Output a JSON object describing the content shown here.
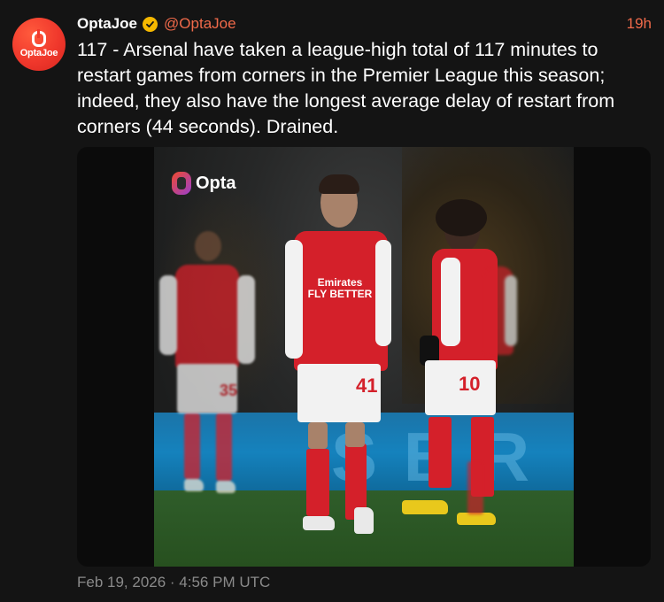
{
  "author": {
    "display_name": "OptaJoe",
    "handle": "@OptaJoe",
    "avatar_text": "OptaJoe",
    "verified": true
  },
  "time_ago": "19h",
  "text": "117 - Arsenal have taken a league-high total of 117 minutes to restart games from corners in the Premier League this season; indeed, they also have the longest average delay of restart from corners (44 seconds). Drained.",
  "media": {
    "logo_text": "Opta",
    "sponsor_text": "Emirates\nFLY BETTER",
    "numbers": [
      "41",
      "10",
      "35"
    ]
  },
  "timestamp": "Feb 19, 2026 · 4:56 PM UTC",
  "colors": {
    "accent": "#f06a4a",
    "verified": "#f5b800",
    "background": "#141414",
    "arsenal_red": "#d4202a"
  },
  "icons": {
    "verified": "verified-badge-icon",
    "avatar": "opta-logo-icon"
  }
}
